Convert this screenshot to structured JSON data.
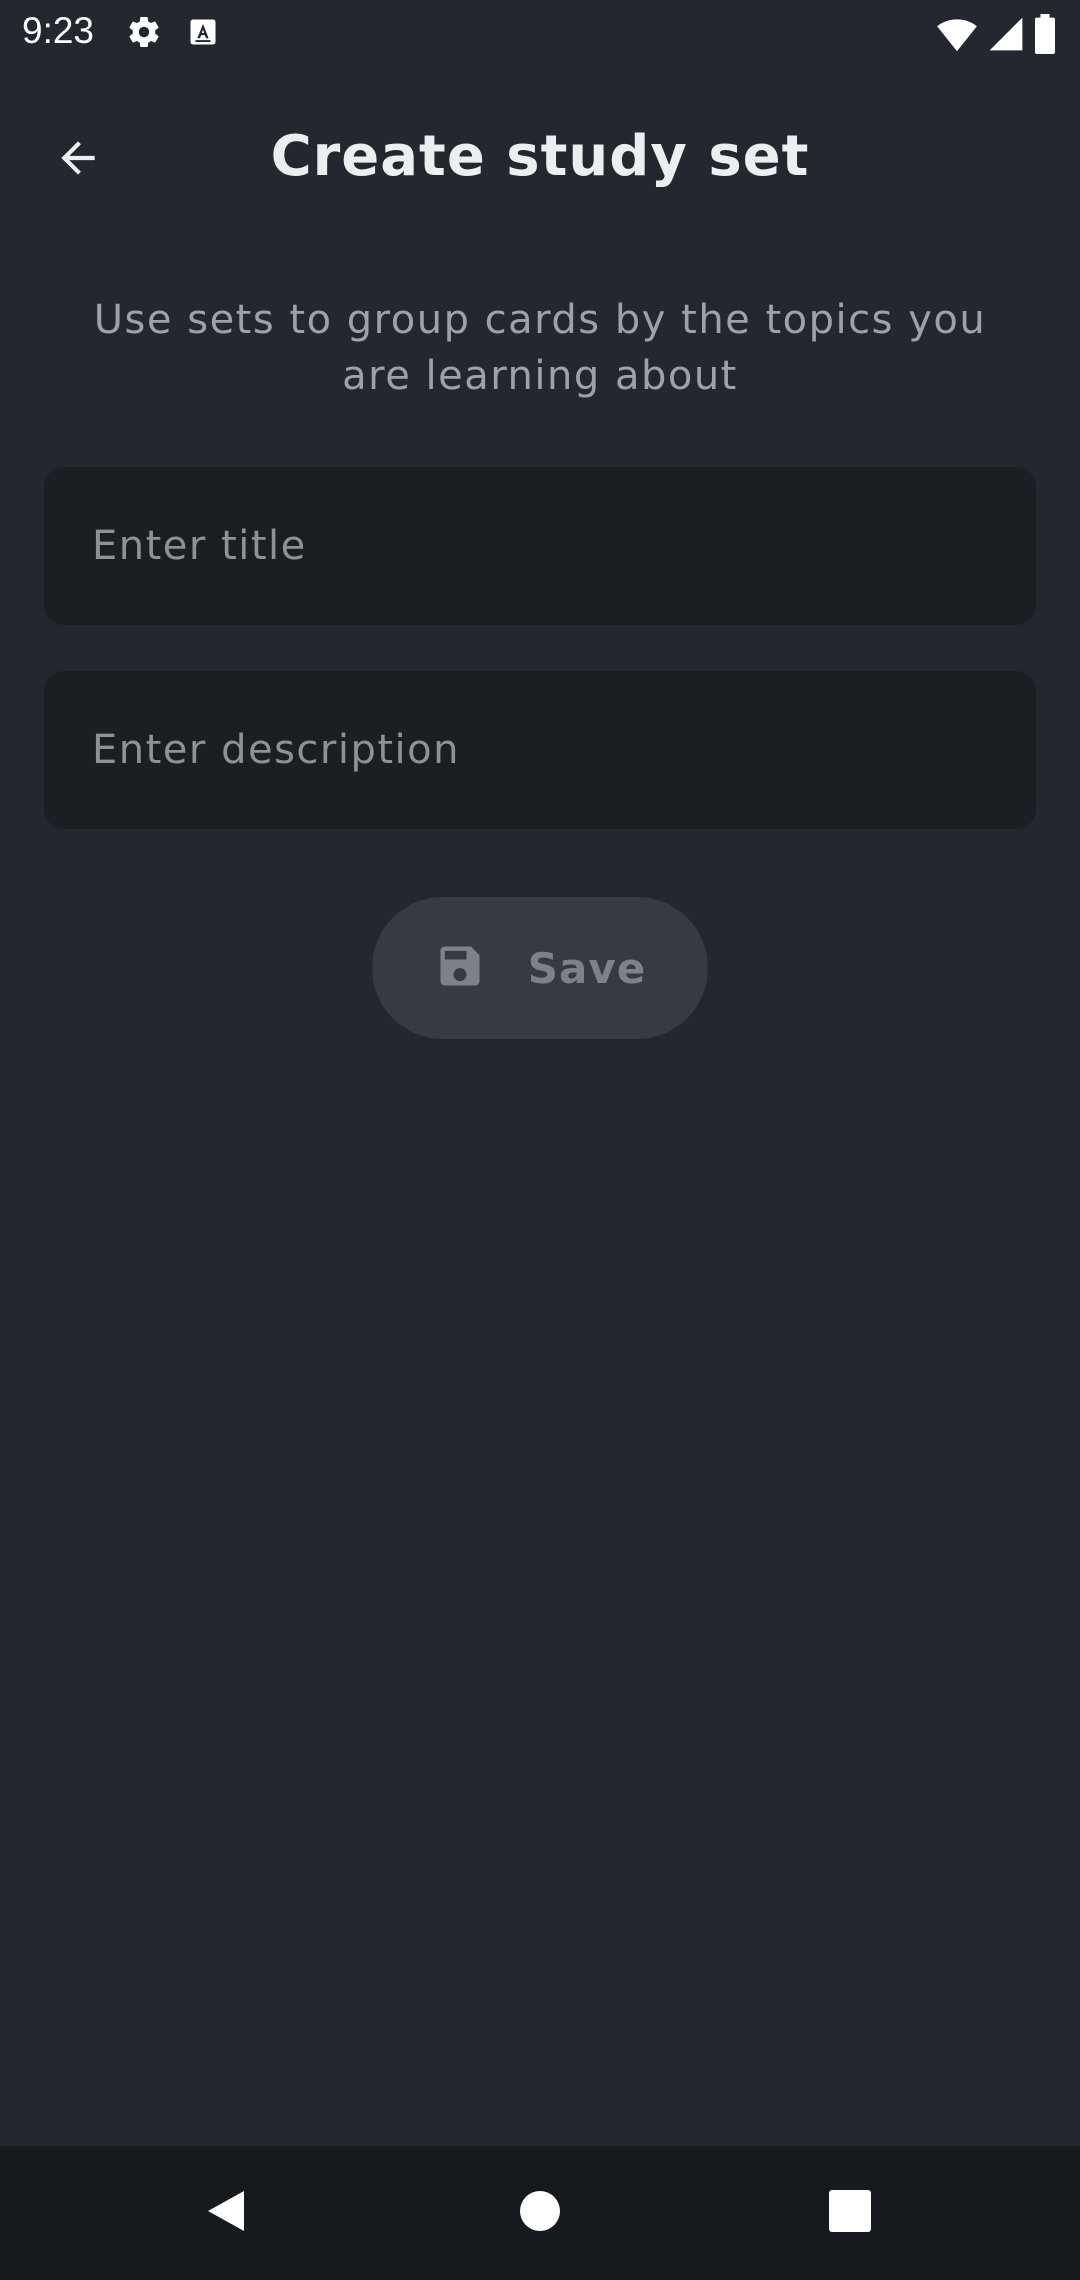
{
  "status_bar": {
    "time": "9:23",
    "left_icons": [
      "gear-icon",
      "a-box-icon"
    ],
    "right_icons": [
      "wifi-icon",
      "signal-icon",
      "battery-icon"
    ]
  },
  "app_bar": {
    "back_icon": "arrow-left-icon",
    "title": "Create study set"
  },
  "form": {
    "subtitle": "Use sets to group cards by the topics you are learning about",
    "title_field": {
      "value": "",
      "placeholder": "Enter title"
    },
    "description_field": {
      "value": "",
      "placeholder": "Enter description"
    },
    "save_button": {
      "icon": "floppy-disk-icon",
      "label": "Save",
      "state": "disabled"
    }
  },
  "nav_bar": {
    "buttons": [
      "back-triangle-icon",
      "home-circle-icon",
      "recents-square-icon"
    ]
  },
  "colors": {
    "background": "#23272f",
    "field_background": "#1b1e22",
    "button_background": "#373b41",
    "nav_background": "#16191d",
    "text_primary": "#eceef0",
    "text_secondary": "#9ea2a8"
  }
}
